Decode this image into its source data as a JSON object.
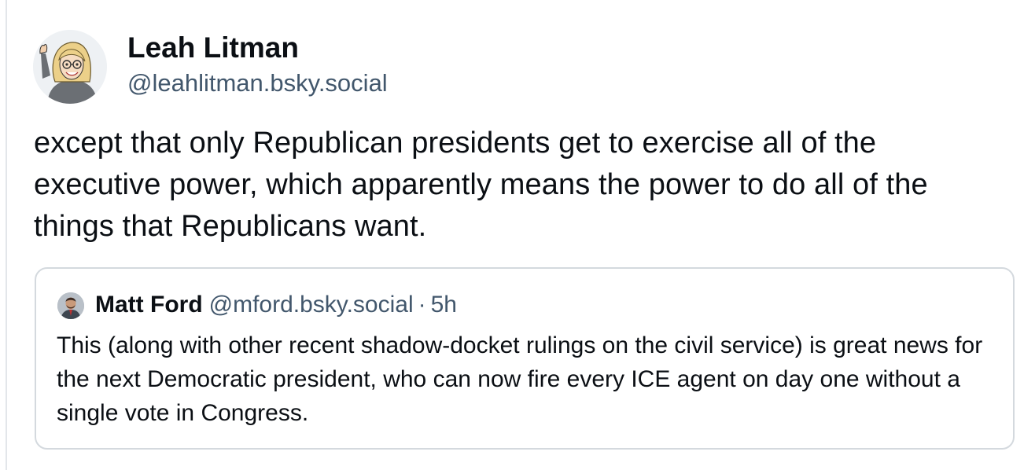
{
  "post": {
    "author": {
      "name": "Leah Litman",
      "handle": "@leahlitman.bsky.social"
    },
    "text": "except that only Republican presidents get to exercise all of the executive power, which apparently means the power to do all of the things that Republicans want.",
    "quote": {
      "author_name": "Matt Ford",
      "author_handle": "@mford.bsky.social",
      "separator": "·",
      "time": "5h",
      "text": "This (along with other recent shadow-docket rulings on the civil service) is great news for the next Democratic president, who can now fire every ICE agent on day one without a single vote in Congress."
    }
  },
  "icons": {
    "author_avatar": "cartoon-avatar-icon",
    "quote_avatar": "user-photo-avatar-icon"
  },
  "colors": {
    "text_primary": "#0b0f14",
    "text_secondary": "#42576c",
    "border": "#d4d9de"
  }
}
